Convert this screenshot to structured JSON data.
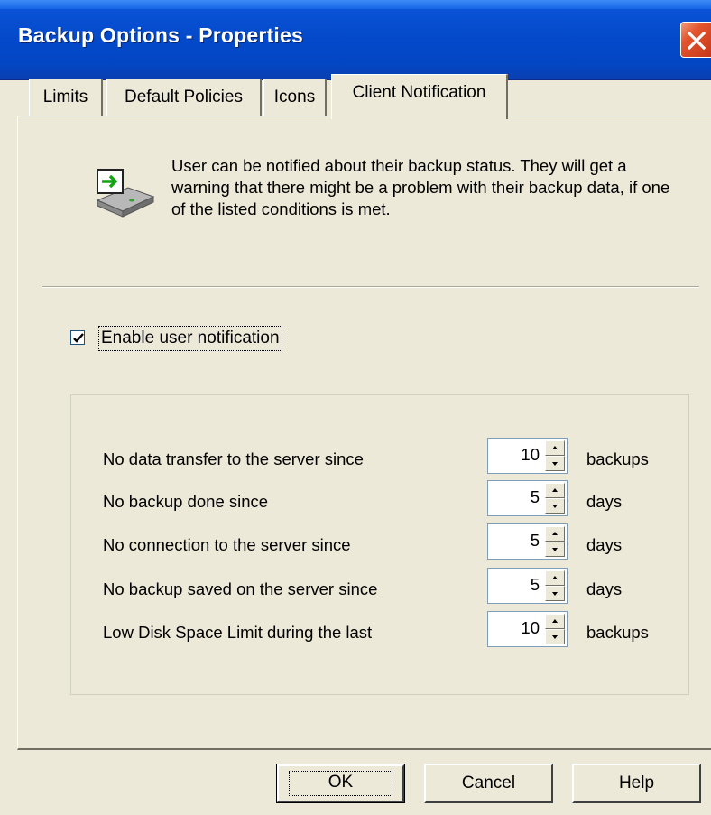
{
  "window": {
    "title": "Backup Options - Properties"
  },
  "tabs": [
    {
      "label": "Limits",
      "active": false
    },
    {
      "label": "Default Policies",
      "active": false
    },
    {
      "label": "Icons",
      "active": false
    },
    {
      "label": "Client Notification",
      "active": true
    }
  ],
  "info": {
    "icon": "backup-drive-icon",
    "text": "User can be notified about their backup status. They will get a warning that there might be a problem with their backup data, if one of the listed conditions is met."
  },
  "enable_notification": {
    "label": "Enable user notification",
    "checked": true
  },
  "conditions": [
    {
      "label": "No data transfer to the server since",
      "value": "10",
      "unit": "backups"
    },
    {
      "label": "No backup done since",
      "value": "5",
      "unit": "days"
    },
    {
      "label": "No connection to the server since",
      "value": "5",
      "unit": "days"
    },
    {
      "label": "No backup saved on the server since",
      "value": "5",
      "unit": "days"
    },
    {
      "label": "Low Disk Space Limit during the last",
      "value": "10",
      "unit": "backups"
    }
  ],
  "buttons": {
    "ok": "OK",
    "cancel": "Cancel",
    "help": "Help"
  },
  "colors": {
    "titlebar": "#0349C9",
    "dialog_bg": "#ECE9D8",
    "close_button": "#E2552D"
  }
}
